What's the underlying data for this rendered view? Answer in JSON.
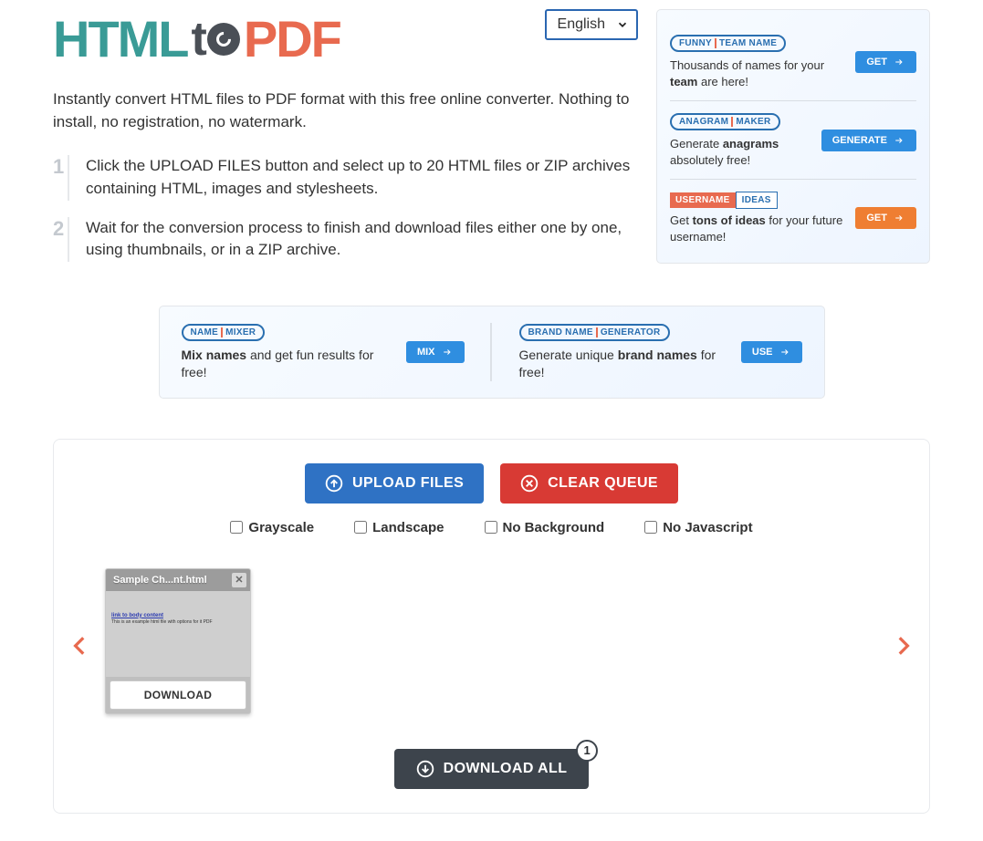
{
  "logo": {
    "part1": "HTML",
    "part2": "t",
    "part3": "PDF"
  },
  "language": {
    "selected": "English"
  },
  "description": "Instantly convert HTML files to PDF format with this free online converter. Nothing to install, no registration, no watermark.",
  "steps": [
    {
      "num": "1",
      "text": "Click the UPLOAD FILES button and select up to 20 HTML files or ZIP archives containing HTML, images and stylesheets."
    },
    {
      "num": "2",
      "text": "Wait for the conversion process to finish and download files either one by one, using thumbnails, or in a ZIP archive."
    }
  ],
  "ads": {
    "side": [
      {
        "tag1": "FUNNY",
        "tag2": "TEAM NAME",
        "text_pre": "Thousands of names for your ",
        "text_bold": "team",
        "text_post": " are here!",
        "btn": "GET"
      },
      {
        "tag1": "ANAGRAM",
        "tag2": "MAKER",
        "text_pre": "Generate ",
        "text_bold": "anagrams",
        "text_post": " absolutely free!",
        "btn": "GENERATE"
      },
      {
        "tag1": "USERNAME",
        "tag2": "IDEAS",
        "text_pre": "Get ",
        "text_bold": "tons of ideas",
        "text_post": " for your future username!",
        "btn": "GET",
        "orange": true,
        "boxed": true
      }
    ],
    "mid": [
      {
        "tag1": "NAME",
        "tag2": "MIXER",
        "text_bold": "Mix names",
        "text_post": " and get fun results for free!",
        "btn": "MIX"
      },
      {
        "tag1": "BRAND NAME",
        "tag2": "GENERATOR",
        "text_pre": "Generate unique ",
        "text_bold": "brand names",
        "text_post": " for free!",
        "btn": "USE"
      }
    ]
  },
  "buttons": {
    "upload": "UPLOAD FILES",
    "clear": "CLEAR QUEUE",
    "download_all": "DOWNLOAD ALL"
  },
  "options": {
    "grayscale": "Grayscale",
    "landscape": "Landscape",
    "nobg": "No Background",
    "nojs": "No Javascript"
  },
  "files": [
    {
      "name": "Sample Ch...nt.html",
      "download": "DOWNLOAD"
    }
  ],
  "badge_count": "1"
}
